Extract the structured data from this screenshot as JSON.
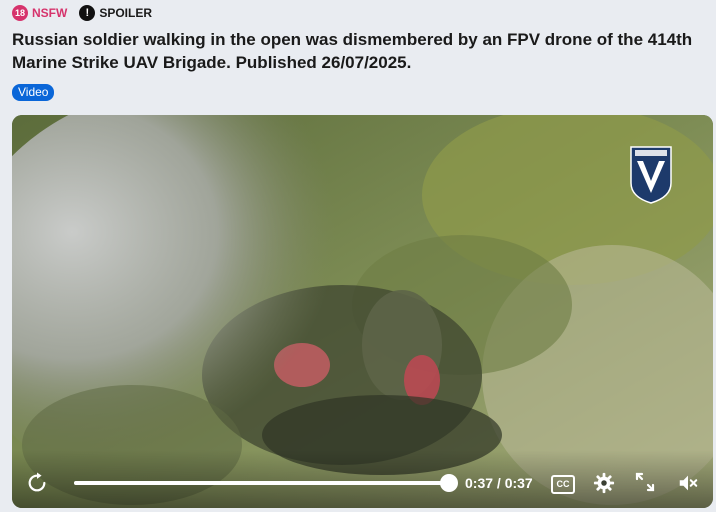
{
  "tags": {
    "nsfw_badge": "18",
    "nsfw_label": "NSFW",
    "spoiler_icon": "!",
    "spoiler_label": "SPOILER"
  },
  "post": {
    "title": "Russian soldier walking in the open was dismembered by an FPV drone of the 414th Marine Strike UAV Brigade. Published 26/07/2025.",
    "flair": "Video"
  },
  "player": {
    "time": "0:37 / 0:37",
    "progress": 1.0,
    "cc_label": "CC",
    "icons": [
      "replay-icon",
      "settings-gear-icon",
      "fullscreen-icon",
      "muted-speaker-icon"
    ]
  },
  "colors": {
    "nsfw": "#d6336c",
    "flair": "#0a66d8",
    "page_bg": "#e9ecf1"
  }
}
